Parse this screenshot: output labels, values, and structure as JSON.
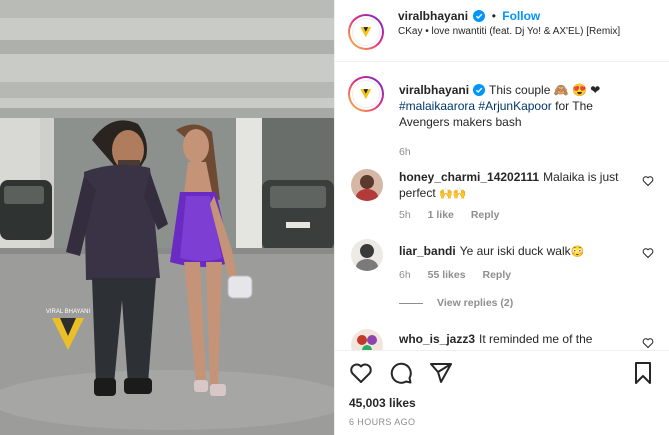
{
  "post": {
    "author": "viralbhayani",
    "follow_label": "Follow",
    "separator": "•",
    "music": "CKay • love nwantiti (feat. Dj Yo! & AX'EL) [Remix]",
    "watermark": "VIRAL BHAYANI"
  },
  "caption": {
    "username": "viralbhayani",
    "text_start": "This couple 🙈 😍 ❤",
    "tag1": "#malaikaarora",
    "tag2": "#ArjunKapoor",
    "text_end": "for The Avengers makers bash",
    "time": "6h"
  },
  "comments": [
    {
      "username": "honey_charmi_14202111",
      "text": "Malaika is just perfect",
      "emoji": "🙌🙌",
      "time": "5h",
      "likes": "1 like",
      "reply": "Reply"
    },
    {
      "username": "liar_bandi",
      "text": "Ye aur iski duck walk",
      "emoji": "😳",
      "time": "6h",
      "likes": "55 likes",
      "reply": "Reply",
      "view_replies": "View replies (2)"
    },
    {
      "username": "who_is_jazz3",
      "text": "It reminded me of the"
    }
  ],
  "actions": {
    "likes": "45,003 likes",
    "posted": "6 HOURS AGO"
  },
  "colors": {
    "link": "#0095f6",
    "hashtag": "#00376b",
    "muted": "#8e8e8e",
    "dress": "#6a2bc2"
  },
  "icons": [
    "verified-icon",
    "heart-icon",
    "comment-icon",
    "share-icon",
    "bookmark-icon"
  ]
}
